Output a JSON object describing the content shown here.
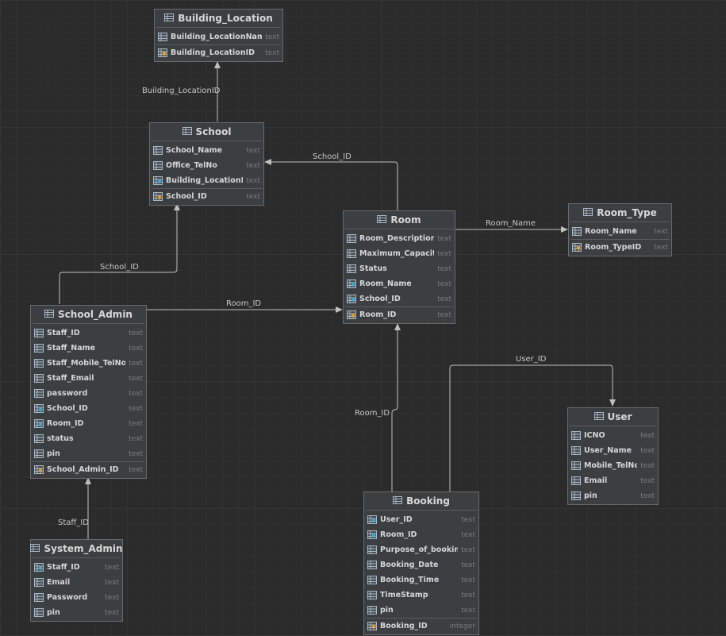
{
  "tables": [
    {
      "id": "building_location",
      "title": "Building_Location",
      "columns": [
        {
          "name": "Building_LocationName",
          "type": "text",
          "key": "none"
        }
      ],
      "pk": {
        "name": "Building_LocationID",
        "type": "text"
      }
    },
    {
      "id": "school",
      "title": "School",
      "columns": [
        {
          "name": "School_Name",
          "type": "text",
          "key": "none"
        },
        {
          "name": "Office_TelNo",
          "type": "text",
          "key": "none"
        },
        {
          "name": "Building_LocationID",
          "type": "text",
          "key": "fk"
        }
      ],
      "pk": {
        "name": "School_ID",
        "type": "text"
      }
    },
    {
      "id": "room",
      "title": "Room",
      "columns": [
        {
          "name": "Room_Description",
          "type": "text",
          "key": "none"
        },
        {
          "name": "Maximum_Capacity",
          "type": "text",
          "key": "none"
        },
        {
          "name": "Status",
          "type": "text",
          "key": "none"
        },
        {
          "name": "Room_Name",
          "type": "text",
          "key": "fk"
        },
        {
          "name": "School_ID",
          "type": "text",
          "key": "fk"
        }
      ],
      "pk": {
        "name": "Room_ID",
        "type": "text"
      }
    },
    {
      "id": "room_type",
      "title": "Room_Type",
      "columns": [
        {
          "name": "Room_Name",
          "type": "text",
          "key": "none"
        }
      ],
      "pk": {
        "name": "Room_TypeID",
        "type": "text"
      }
    },
    {
      "id": "school_admin",
      "title": "School_Admin",
      "columns": [
        {
          "name": "Staff_ID",
          "type": "text",
          "key": "none"
        },
        {
          "name": "Staff_Name",
          "type": "text",
          "key": "none"
        },
        {
          "name": "Staff_Mobile_TelNo",
          "type": "text",
          "key": "none"
        },
        {
          "name": "Staff_Email",
          "type": "text",
          "key": "none"
        },
        {
          "name": "password",
          "type": "text",
          "key": "none"
        },
        {
          "name": "School_ID",
          "type": "text",
          "key": "fk"
        },
        {
          "name": "Room_ID",
          "type": "text",
          "key": "fk"
        },
        {
          "name": "status",
          "type": "text",
          "key": "none"
        },
        {
          "name": "pin",
          "type": "text",
          "key": "none"
        }
      ],
      "pk": {
        "name": "School_Admin_ID",
        "type": "text"
      }
    },
    {
      "id": "user",
      "title": "User",
      "columns": [
        {
          "name": "ICNO",
          "type": "text",
          "key": "none"
        },
        {
          "name": "User_Name",
          "type": "text",
          "key": "none"
        },
        {
          "name": "Mobile_TelNo",
          "type": "text",
          "key": "none"
        },
        {
          "name": "Email",
          "type": "text",
          "key": "none"
        },
        {
          "name": "pin",
          "type": "text",
          "key": "none"
        }
      ],
      "pk": null
    },
    {
      "id": "system_admin",
      "title": "System_Admin",
      "columns": [
        {
          "name": "Staff_ID",
          "type": "text",
          "key": "fk"
        },
        {
          "name": "Email",
          "type": "text",
          "key": "none"
        },
        {
          "name": "Password",
          "type": "text",
          "key": "none"
        },
        {
          "name": "pin",
          "type": "text",
          "key": "none"
        }
      ],
      "pk": null
    },
    {
      "id": "booking",
      "title": "Booking",
      "columns": [
        {
          "name": "User_ID",
          "type": "text",
          "key": "fk"
        },
        {
          "name": "Room_ID",
          "type": "text",
          "key": "fk"
        },
        {
          "name": "Purpose_of_booking",
          "type": "text",
          "key": "none"
        },
        {
          "name": "Booking_Date",
          "type": "text",
          "key": "none"
        },
        {
          "name": "Booking_Time",
          "type": "text",
          "key": "none"
        },
        {
          "name": "TimeStamp",
          "type": "text",
          "key": "none"
        },
        {
          "name": "pin",
          "type": "text",
          "key": "none"
        }
      ],
      "pk": {
        "name": "Booking_ID",
        "type": "integer"
      }
    }
  ],
  "relations": [
    {
      "id": "school-building",
      "label": "Building_LocationID"
    },
    {
      "id": "room-school",
      "label": "School_ID"
    },
    {
      "id": "room-roomtype",
      "label": "Room_Name"
    },
    {
      "id": "admin-school",
      "label": "School_ID"
    },
    {
      "id": "admin-room",
      "label": "Room_ID"
    },
    {
      "id": "booking-room",
      "label": "Room_ID"
    },
    {
      "id": "booking-user",
      "label": "User_ID"
    },
    {
      "id": "sysadmin-admin",
      "label": "Staff_ID"
    }
  ],
  "colors": {
    "background": "#2b2b2b",
    "table": "#3c3f41",
    "edge": "#bfbfbf",
    "pk_key": "#e0a030",
    "fk_key": "#3fa7d6",
    "column_icon": "#a9b7c6"
  }
}
